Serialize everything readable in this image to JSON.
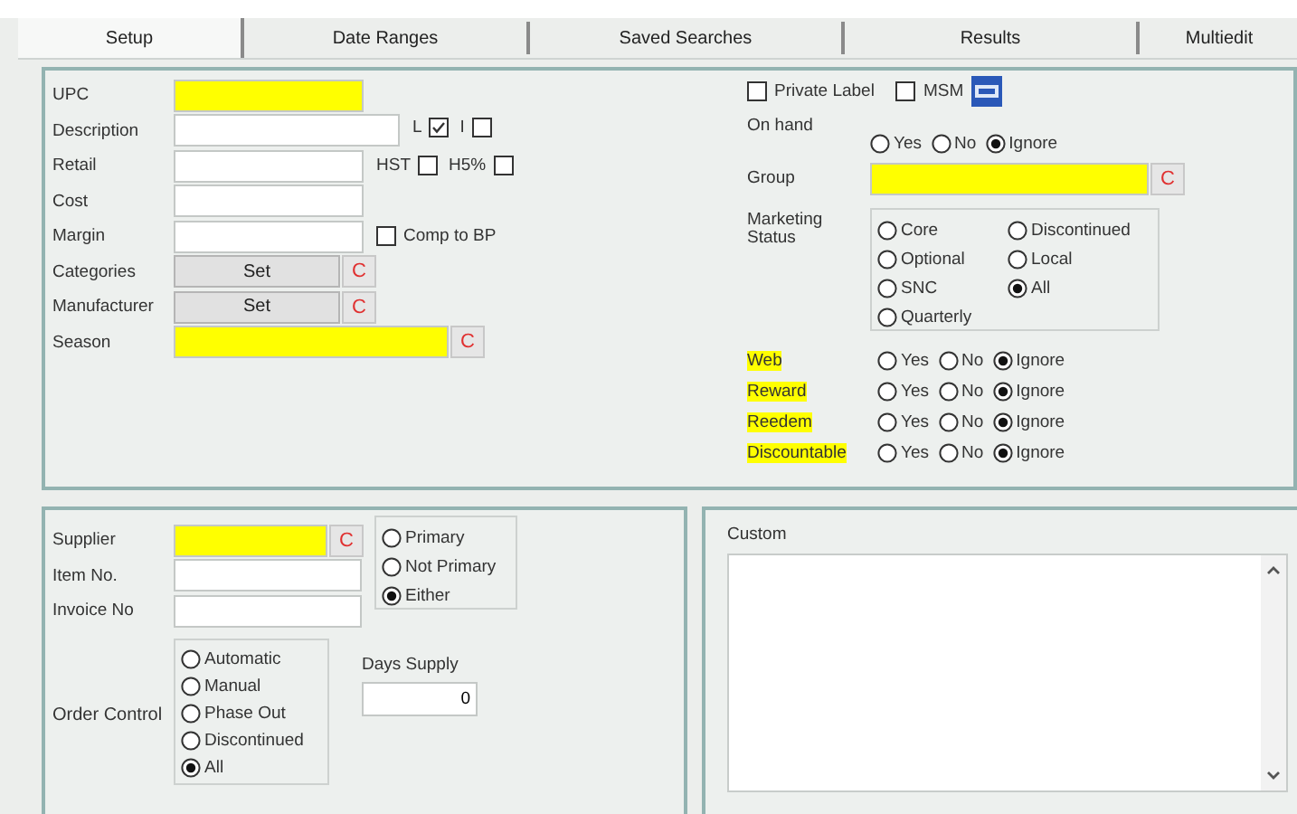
{
  "tabs": [
    {
      "label": "Setup",
      "selected": true
    },
    {
      "label": "Date Ranges",
      "selected": false
    },
    {
      "label": "Saved Searches",
      "selected": false
    },
    {
      "label": "Results",
      "selected": false
    },
    {
      "label": "Multiedit",
      "selected": false
    }
  ],
  "item_fields": [
    {
      "label": "UPC",
      "kind": "input",
      "highlighted": true
    },
    {
      "label": "Description",
      "kind": "input",
      "highlighted": false,
      "checkboxes": [
        {
          "label": "L",
          "checked": true,
          "kind": "label-first"
        },
        {
          "label": "I",
          "checked": false,
          "kind": "label-first"
        }
      ]
    },
    {
      "label": "Retail",
      "kind": "input",
      "highlighted": false,
      "checkboxes": [
        {
          "label": "HST",
          "checked": false,
          "kind": "label-first"
        },
        {
          "label": "H5%",
          "checked": false,
          "kind": "label-first"
        }
      ]
    },
    {
      "label": "Cost",
      "kind": "input",
      "highlighted": false
    },
    {
      "label": "Margin",
      "kind": "input",
      "highlighted": false,
      "checkboxes": [
        {
          "label": "Comp to BP",
          "checked": false,
          "kind": "box-first"
        }
      ]
    },
    {
      "label": "Categories",
      "kind": "set",
      "button": "Set",
      "clear": "C"
    },
    {
      "label": "Manufacturer",
      "kind": "set",
      "button": "Set",
      "clear": "C"
    },
    {
      "label": "Season",
      "kind": "input",
      "highlighted": true,
      "clear": "C"
    }
  ],
  "flags": [
    {
      "label": "Private Label",
      "checked": false
    },
    {
      "label": "MSM",
      "checked": false
    }
  ],
  "on_hand": {
    "label": "On hand",
    "options": [
      {
        "label": "Yes",
        "selected": false
      },
      {
        "label": "No",
        "selected": false
      },
      {
        "label": "Ignore",
        "selected": true
      }
    ]
  },
  "group": {
    "label": "Group",
    "highlighted": true,
    "clear": "C"
  },
  "marketing_status": {
    "label": "Marketing Status",
    "options": [
      {
        "label": "Core",
        "selected": false
      },
      {
        "label": "Discontinued",
        "selected": false
      },
      {
        "label": "Optional",
        "selected": false
      },
      {
        "label": "Local",
        "selected": false
      },
      {
        "label": "SNC",
        "selected": false
      },
      {
        "label": "All",
        "selected": true
      },
      {
        "label": "Quarterly",
        "selected": false
      }
    ]
  },
  "yes_no_filters": [
    {
      "label": "Web",
      "highlighted": true,
      "options": [
        {
          "label": "Yes",
          "selected": false
        },
        {
          "label": "No",
          "selected": false
        },
        {
          "label": "Ignore",
          "selected": true
        }
      ]
    },
    {
      "label": "Reward",
      "highlighted": true,
      "options": [
        {
          "label": "Yes",
          "selected": false
        },
        {
          "label": "No",
          "selected": false
        },
        {
          "label": "Ignore",
          "selected": true
        }
      ]
    },
    {
      "label": "Reedem",
      "highlighted": true,
      "options": [
        {
          "label": "Yes",
          "selected": false
        },
        {
          "label": "No",
          "selected": false
        },
        {
          "label": "Ignore",
          "selected": true
        }
      ]
    },
    {
      "label": "Discountable",
      "highlighted": true,
      "options": [
        {
          "label": "Yes",
          "selected": false
        },
        {
          "label": "No",
          "selected": false
        },
        {
          "label": "Ignore",
          "selected": true
        }
      ]
    }
  ],
  "supplier": {
    "label": "Supplier",
    "highlighted": true,
    "clear": "C",
    "options": [
      {
        "label": "Primary",
        "selected": false
      },
      {
        "label": "Not Primary",
        "selected": false
      },
      {
        "label": "Either",
        "selected": true
      }
    ]
  },
  "item_no": {
    "label": "Item No."
  },
  "invoice_no": {
    "label": "Invoice No"
  },
  "order_control": {
    "label": "Order Control",
    "options": [
      {
        "label": "Automatic",
        "selected": false
      },
      {
        "label": "Manual",
        "selected": false
      },
      {
        "label": "Phase Out",
        "selected": false
      },
      {
        "label": "Discontinued",
        "selected": false
      },
      {
        "label": "All",
        "selected": true
      }
    ]
  },
  "days_supply": {
    "label": "Days Supply",
    "value": "0"
  },
  "custom": {
    "label": "Custom"
  }
}
